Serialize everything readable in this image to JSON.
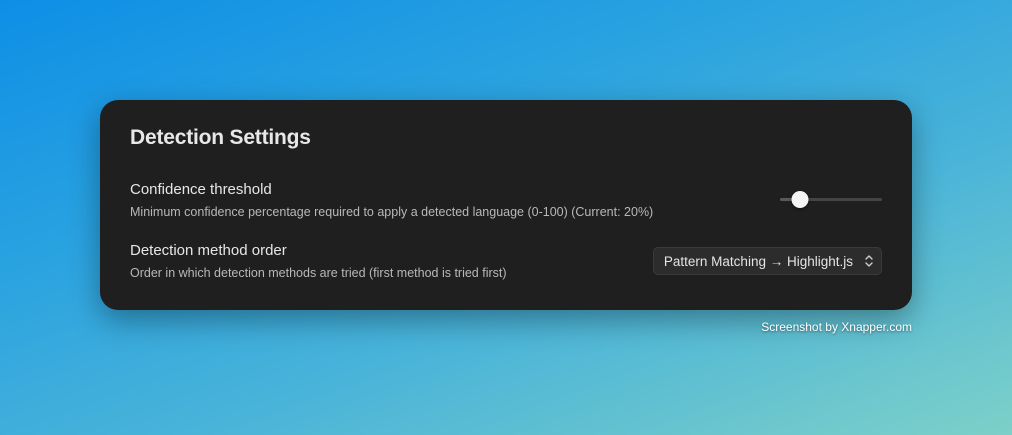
{
  "panel": {
    "title": "Detection Settings",
    "settings": [
      {
        "label": "Confidence threshold",
        "description": "Minimum confidence percentage required to apply a detected language (0-100) (Current: 20%)",
        "control": "slider",
        "value": 20,
        "min": 0,
        "max": 100
      },
      {
        "label": "Detection method order",
        "description": "Order in which detection methods are tried (first method is tried first)",
        "control": "select",
        "selected": "Pattern Matching → Highlight.js",
        "icon": "chevron-up-down-icon"
      }
    ]
  },
  "watermark": "Screenshot by Xnapper.com",
  "colors": {
    "panel_bg": "#1f1f1f",
    "text_primary": "#e6e6e6",
    "text_secondary": "#b8b8b8",
    "slider_thumb": "#f4f4f4"
  }
}
